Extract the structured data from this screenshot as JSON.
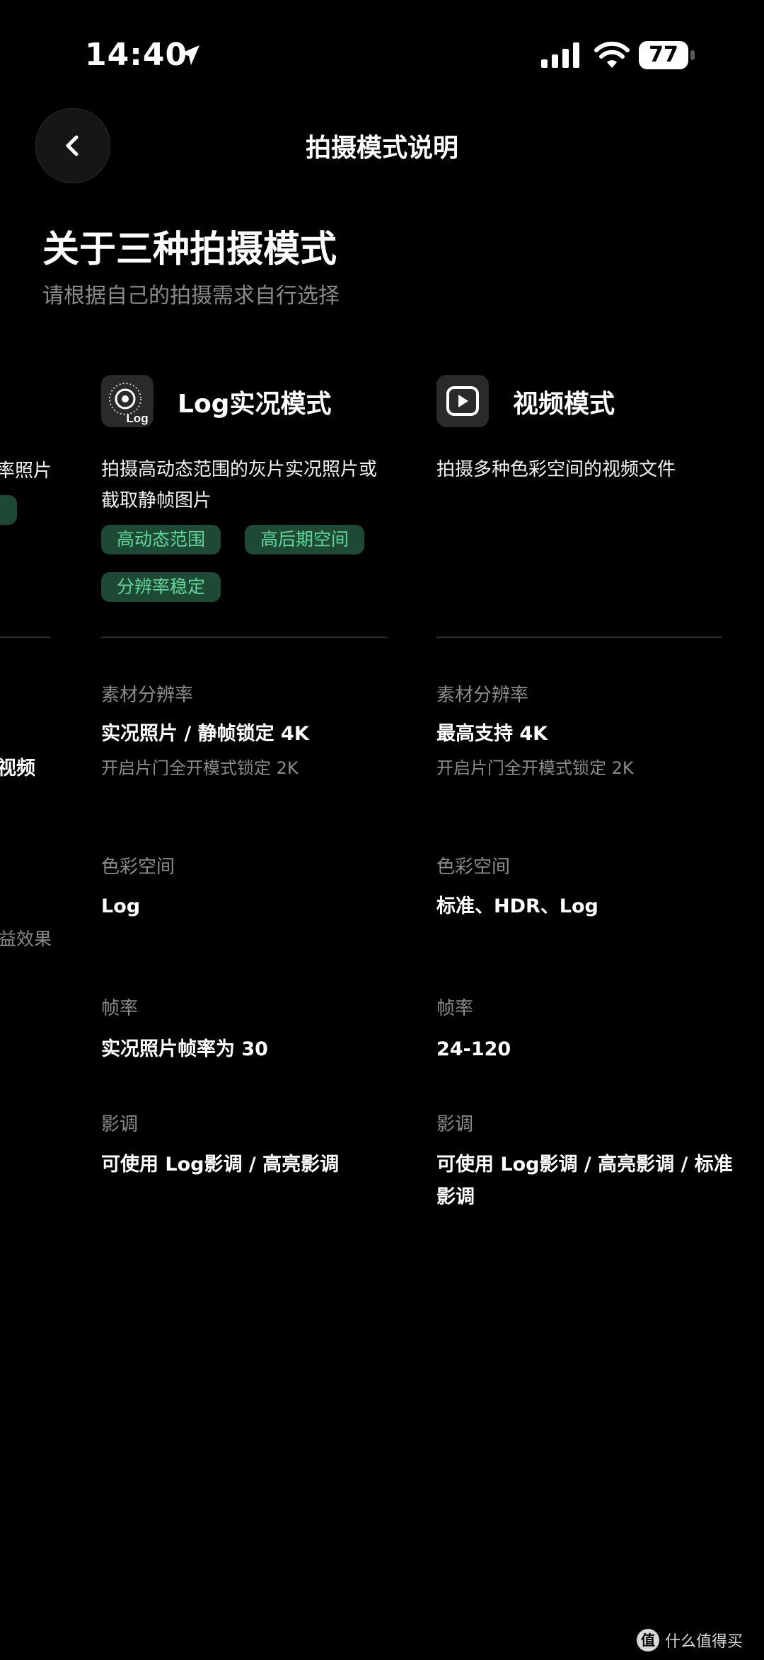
{
  "status_bar": {
    "time": "14:40",
    "battery": "77"
  },
  "nav": {
    "title": "拍摄模式说明"
  },
  "header": {
    "title": "关于三种拍摄模式",
    "subtitle": "请根据自己的拍摄需求自行选择"
  },
  "partial_card": {
    "desc_fragment": "率照片",
    "resolution_fragment": "视频",
    "effect_fragment": "益效果"
  },
  "cards": [
    {
      "name": "Log实况模式",
      "icon": "log-live-icon",
      "icon_text": "Log",
      "desc_line1": "拍摄高动态范围的灰片实况照片或",
      "desc_line2": "截取静帧图片",
      "tags": [
        "高动态范围",
        "高后期空间",
        "分辨率稳定"
      ],
      "specs": {
        "resolution_label": "素材分辨率",
        "resolution_value": "实况照片 / 静帧锁定 4K",
        "resolution_note": "开启片门全开模式锁定 2K",
        "color_label": "色彩空间",
        "color_value": "Log",
        "fps_label": "帧率",
        "fps_value": "实况照片帧率为 30",
        "tone_label": "影调",
        "tone_value": "可使用 Log影调 / 高亮影调"
      }
    },
    {
      "name": "视频模式",
      "icon": "play-icon",
      "desc_line1": "拍摄多种色彩空间的视频文件",
      "specs": {
        "resolution_label": "素材分辨率",
        "resolution_value": "最高支持 4K",
        "resolution_note": "开启片门全开模式锁定 2K",
        "color_label": "色彩空间",
        "color_value": "标准、HDR、Log",
        "fps_label": "帧率",
        "fps_value": "24-120",
        "tone_label": "影调",
        "tone_value_line1": "可使用 Log影调 / 高亮影调 / 标准",
        "tone_value_line2": "影调"
      }
    }
  ],
  "watermark": {
    "text": "什么值得买",
    "logo": "值"
  },
  "colors": {
    "background": "#000000",
    "tag_bg": "#1e4a35",
    "tag_text": "#5fd79a",
    "muted": "#8c8c8c"
  }
}
